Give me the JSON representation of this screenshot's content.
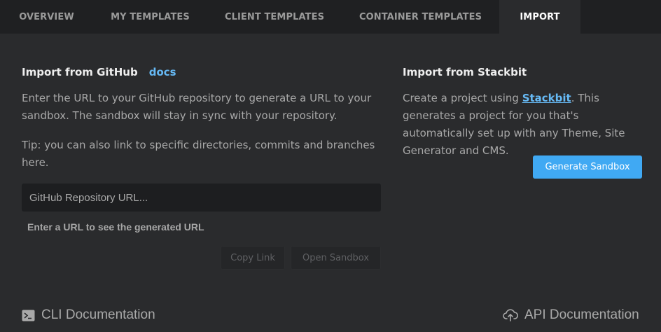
{
  "tabs": [
    {
      "label": "OVERVIEW"
    },
    {
      "label": "MY TEMPLATES"
    },
    {
      "label": "CLIENT TEMPLATES"
    },
    {
      "label": "CONTAINER TEMPLATES"
    },
    {
      "label": "IMPORT",
      "active": true
    }
  ],
  "github": {
    "heading": "Import from GitHub",
    "docs_link": "docs",
    "description": "Enter the URL to your GitHub repository to generate a URL to your sandbox. The sandbox will stay in sync with your repository.",
    "tip": "Tip: you can also link to specific directories, commits and branches here.",
    "input_placeholder": "GitHub Repository URL...",
    "input_value": "",
    "generated_url_hint": "Enter a URL to see the generated URL",
    "copy_link_label": "Copy Link",
    "open_sandbox_label": "Open Sandbox"
  },
  "stackbit": {
    "heading": "Import from Stackbit",
    "text_before_link": "Create a project using ",
    "link_text": "Stackbit",
    "text_after_link": ". This generates a project for you that's automatically set up with any Theme, Site Generator and CMS.",
    "generate_button": "Generate Sandbox"
  },
  "footer": {
    "cli_label": "CLI Documentation",
    "cli_icon": "terminal-icon",
    "api_label": "API Documentation",
    "api_icon": "cloud-upload-icon"
  },
  "colors": {
    "accent": "#40a9f3",
    "link": "#66b9f4",
    "background": "#2a2b2d",
    "tabbar": "#1f2022"
  }
}
